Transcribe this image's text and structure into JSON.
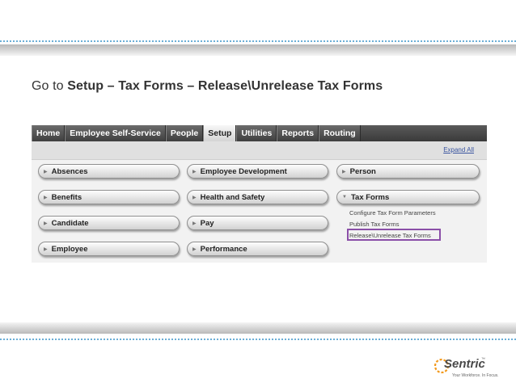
{
  "slide": {
    "title_prefix": "Go to ",
    "title_path": "Setup – Tax Forms – Release\\Unrelease Tax Forms"
  },
  "navbar": {
    "tabs": [
      {
        "label": "Home"
      },
      {
        "label": "Employee Self-Service"
      },
      {
        "label": "People"
      },
      {
        "label": "Setup",
        "active": true
      },
      {
        "label": "Utilities"
      },
      {
        "label": "Reports"
      },
      {
        "label": "Routing"
      }
    ]
  },
  "toolbar": {
    "expand_all": "Expand All"
  },
  "menu": {
    "col1": [
      "Absences",
      "Benefits",
      "Candidate",
      "Employee"
    ],
    "col2": [
      "Employee Development",
      "Health and Safety",
      "Pay",
      "Performance"
    ],
    "col3": [
      "Person",
      "Tax Forms"
    ],
    "tax_forms_links": [
      "Configure Tax Form Parameters",
      "Publish Tax Forms",
      "Release\\Unrelease Tax Forms"
    ]
  },
  "logo": {
    "name": "Sentric",
    "tm": "™",
    "tagline": "Your Workforce. In Focus."
  },
  "colors": {
    "highlight": "#8b4fa8",
    "dotted_rule": "#6aaed6",
    "logo_orange": "#f39a1e"
  }
}
